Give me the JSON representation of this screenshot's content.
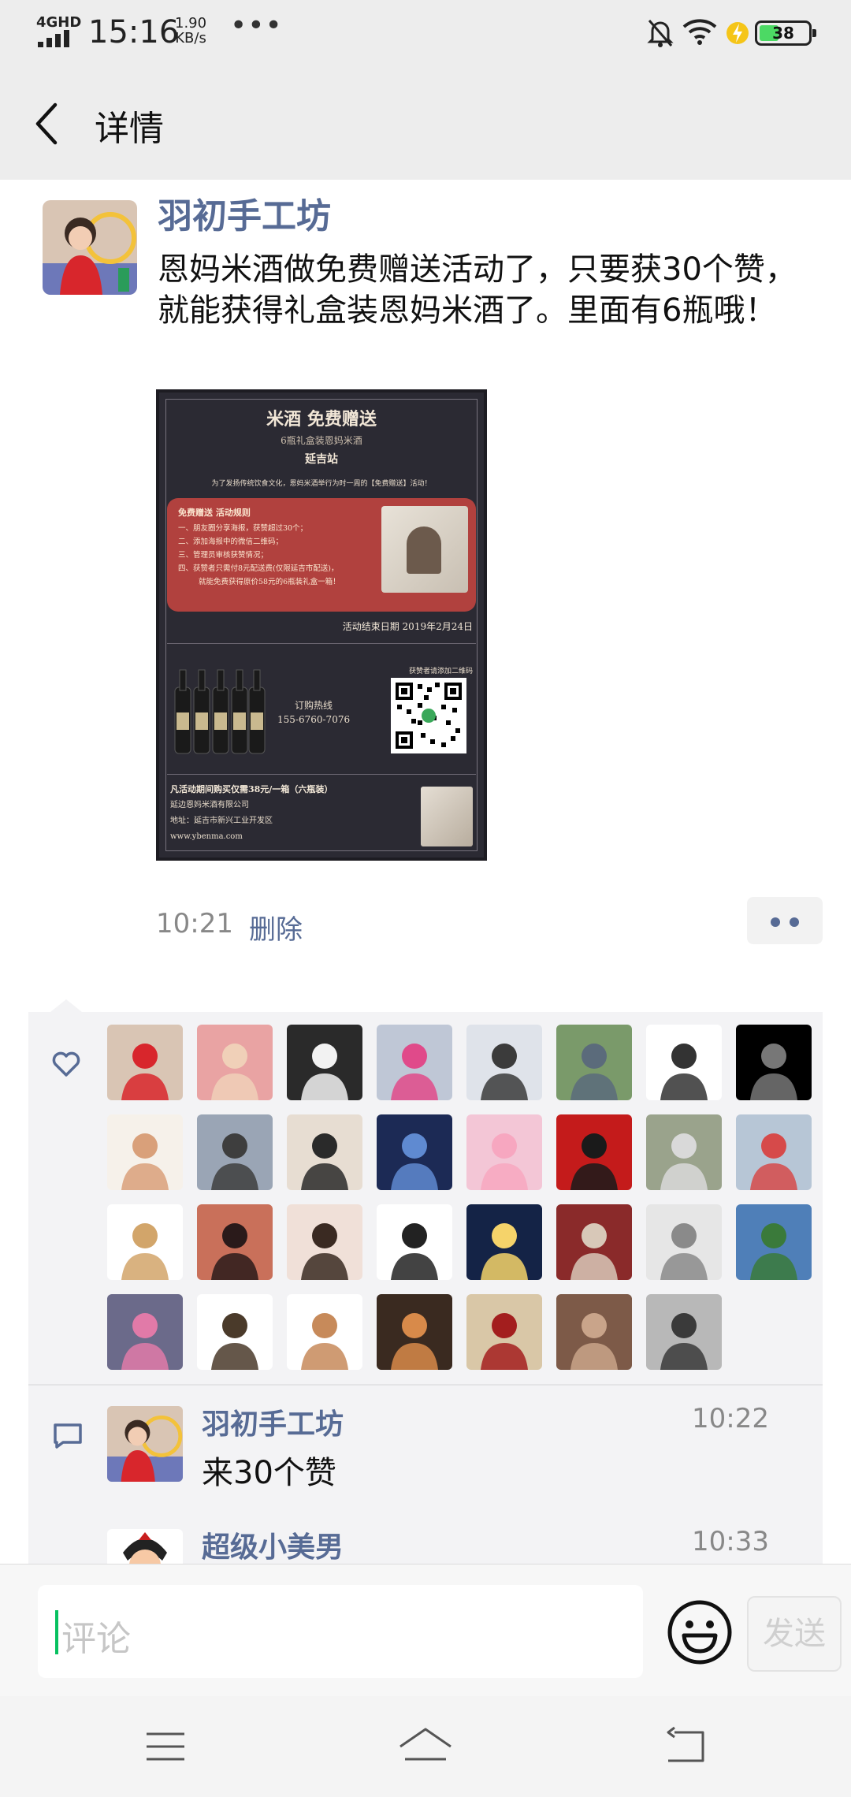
{
  "status_bar": {
    "network": "4GHD",
    "time": "15:16",
    "speed_value": "1.90",
    "speed_unit": "KB/s",
    "more": "•••",
    "battery": "38",
    "battery_level": 0.38
  },
  "nav": {
    "title": "详情"
  },
  "post": {
    "author": "羽初手工坊",
    "text": "恩妈米酒做免费赠送活动了，只要获30个赞，就能获得礼盒装恩妈米酒了。里面有6瓶哦！",
    "time": "10:21",
    "delete_label": "删除"
  },
  "poster": {
    "title": "米酒 免费赠送",
    "subtitle": "6瓶礼盒装恩妈米酒",
    "station": "延吉站",
    "intro": "为了发扬传统饮食文化，恩妈米酒举行为时一周的【免费赠送】活动！",
    "rules_title": "免费赠送 活动规则",
    "rules": [
      "一、朋友圈分享海报，获赞超过30个；",
      "二、添加海报中的微信二维码；",
      "三、管理员审核获赞情况；",
      "四、获赞者只需付8元配送费(仅限延吉市配送)，",
      "就能免费获得原价58元的6瓶装礼盒一箱！"
    ],
    "end_date": "活动结束日期 2019年2月24日",
    "hotline_label": "订购热线",
    "hotline_number": "155-6760-7076",
    "qr_caption": "获赞者请添加二维码",
    "footer_offer": "凡活动期间购买仅需38元/一箱（六瓶装）",
    "footer_company": "延边恩妈米酒有限公司",
    "footer_address": "地址：延吉市新兴工业开发区",
    "footer_url": "www.ybenma.com"
  },
  "comments": [
    {
      "name": "羽初手工坊",
      "time": "10:22",
      "text": "来30个赞"
    },
    {
      "name": "超级小美男",
      "time": "10:33",
      "text": ""
    }
  ],
  "input": {
    "placeholder": "评论",
    "send_label": "发送"
  },
  "colors": {
    "link": "#576b95",
    "accent_green": "#07c160",
    "poster_bg": "#2b2a33",
    "poster_red": "#b1413e"
  },
  "icons": {
    "like": "heart-outline-icon",
    "comment": "speech-bubble-icon",
    "emoji": "smiley-icon",
    "back": "chevron-left-icon"
  }
}
